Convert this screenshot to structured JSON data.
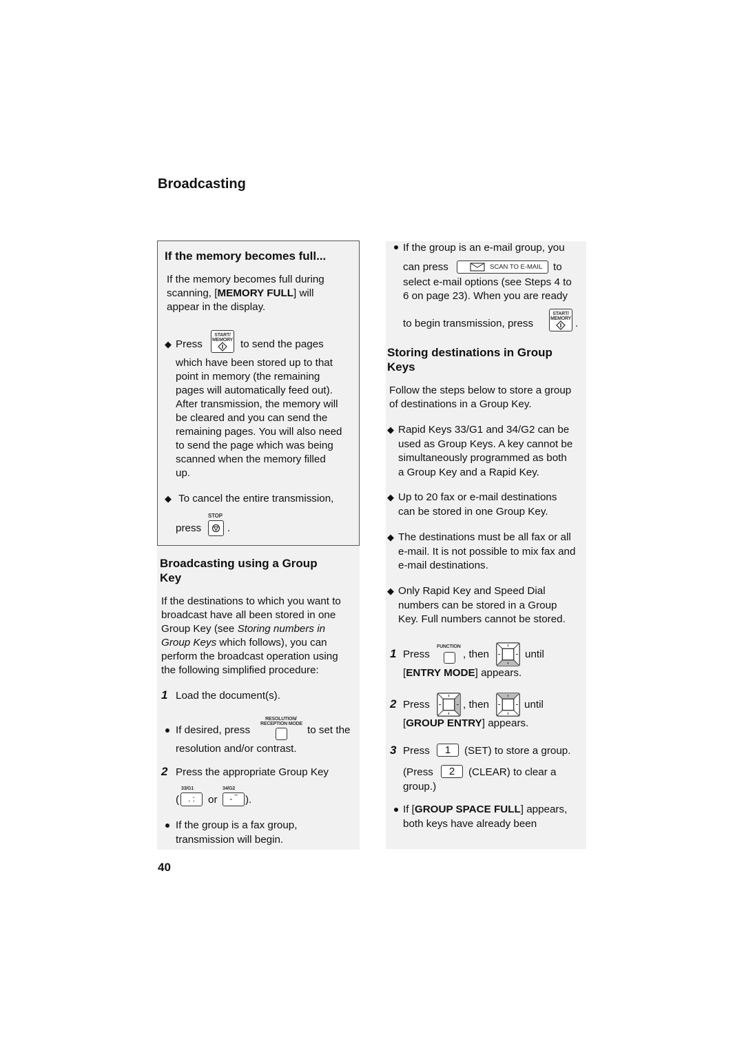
{
  "page": {
    "title": "Broadcasting",
    "number": "40"
  },
  "memory_box": {
    "heading": "If the memory becomes full...",
    "intro_1": "If the memory becomes full during",
    "intro_2_pre": "scanning, [",
    "intro_2_bold": "MEMORY FULL",
    "intro_2_post": "] will",
    "intro_3": "appear in the display.",
    "bullet1_press": "Press",
    "bullet1_after": "to send the pages",
    "bullet1_lines": [
      "which have been stored up to that",
      "point in memory (the remaining",
      "pages will automatically feed out).",
      "After transmission, the memory will",
      "be cleared and you can send the",
      "remaining pages. You will also need",
      "to send the page which was being",
      "scanned when the memory filled",
      "up."
    ],
    "bullet2_line1": "To cancel the entire transmission,",
    "bullet2_press": "press",
    "bullet2_end": ".",
    "start_key_label_1": "START/",
    "start_key_label_2": "MEMORY",
    "stop_key_label": "STOP"
  },
  "group_broadcast": {
    "heading_1": "Broadcasting using a Group",
    "heading_2": "Key",
    "para_1": "If the destinations to which you want to",
    "para_2": "broadcast have all been stored in one",
    "para_3_pre": "Group Key (see ",
    "para_3_italic": "Storing numbers in",
    "para_4_italic": "Group Keys",
    "para_4_post": " which follows), you can",
    "para_5": "perform the broadcast operation using",
    "para_6": "the following simplified procedure:",
    "step1_num": "1",
    "step1_text": "Load the document(s).",
    "step1_bullet_pre": "If desired, press",
    "step1_bullet_post": "to set the",
    "step1_bullet_line2": "resolution and/or contrast.",
    "resolution_key_label_1": "RESOLUTION/",
    "resolution_key_label_2": "RECEPTION MODE",
    "step2_num": "2",
    "step2_text": "Press the appropriate Group Key",
    "step2_open": "(",
    "step2_or": "or",
    "step2_close": ").",
    "key_g1_label": "33/G1",
    "key_g2_label": "34/G2",
    "key_g1_glyph": ". :",
    "key_g2_glyph": "- ‾",
    "step2_bullet_1": "If the group is a fax group,",
    "step2_bullet_2": "transmission will begin."
  },
  "email_group": {
    "bullet_1": "If the group is an e-mail group, you",
    "can_press": "can press",
    "scan_button_label": "SCAN TO E-MAIL",
    "to": "to",
    "line_3": "select e-mail options (see Steps 4 to",
    "line_4": "6  on page 23). When you are ready",
    "line_5": "to begin transmission, press",
    "line_5_end": "."
  },
  "storing": {
    "heading_1": "Storing destinations in Group",
    "heading_2": "Keys",
    "intro_1": "Follow the steps below to store a group",
    "intro_2": "of destinations in a Group Key.",
    "bullets": [
      [
        "Rapid Keys 33/G1 and 34/G2 can be",
        "used as Group Keys. A key cannot be",
        "simultaneously programmed as both",
        "a Group Key and a Rapid Key."
      ],
      [
        "Up to 20 fax or e-mail destinations",
        "can be stored in one Group Key."
      ],
      [
        "The destinations must be all fax or all",
        "e-mail. It is not possible to mix fax and",
        "e-mail destinations."
      ],
      [
        "Only Rapid Key and Speed Dial",
        "numbers can be stored in a Group",
        "Key. Full numbers cannot be stored."
      ]
    ],
    "step1_num": "1",
    "step1_press": "Press",
    "step1_then": ", then",
    "step1_until": "until",
    "step1_line2_open": "[",
    "step1_line2_bold": "ENTRY MODE",
    "step1_line2_post": "] appears.",
    "function_key_label": "FUNCTION",
    "step2_num": "2",
    "step2_press": "Press",
    "step2_then": ", then",
    "step2_until": "until",
    "step2_line2_open": "[",
    "step2_line2_bold": "GROUP ENTRY",
    "step2_line2_post": "] appears.",
    "step3_num": "3",
    "step3_press": "Press",
    "step3_key": "1",
    "step3_after": "(SET) to store a group.",
    "step3b_pre": "(Press",
    "step3b_key": "2",
    "step3b_after": "(CLEAR) to clear a",
    "step3b_line2": "group.)",
    "bullet_pre": "If [",
    "bullet_bold": "GROUP SPACE FULL",
    "bullet_post": "] appears,",
    "bullet_line2": "both keys have already been"
  }
}
